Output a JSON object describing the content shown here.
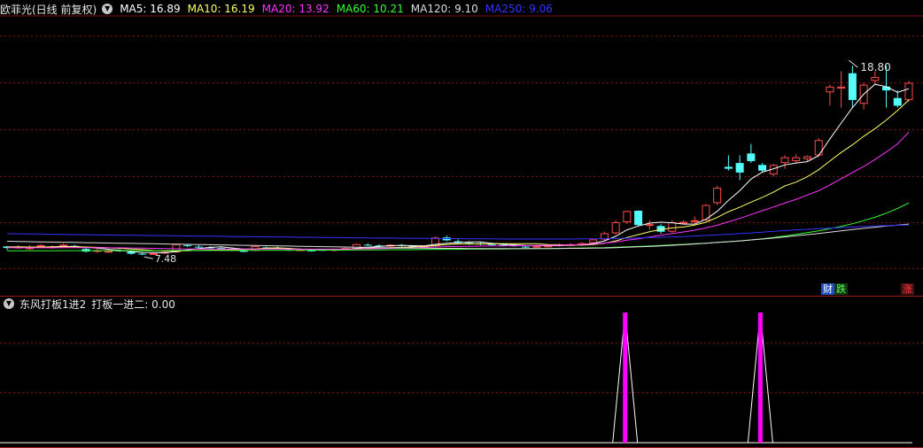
{
  "header": {
    "stock_name": "欧菲光(日线 前复权)",
    "ma": [
      {
        "label": "MA5: 16.89",
        "color": "#ffffff"
      },
      {
        "label": "MA10: 16.19",
        "color": "#ffff66"
      },
      {
        "label": "MA20: 13.92",
        "color": "#ff33ff"
      },
      {
        "label": "MA60: 10.21",
        "color": "#33ff33"
      },
      {
        "label": "MA120: 9.10",
        "color": "#dddddd"
      },
      {
        "label": "MA250: 9.06",
        "color": "#3333ff"
      }
    ]
  },
  "price_panel": {
    "high_label": "18.80",
    "low_label": "7.48",
    "tags": {
      "cai": "财",
      "die": "跌",
      "zhang": "涨"
    },
    "colors": {
      "up": "#ff4a4a",
      "down": "#54fcfc",
      "grid": "#7a1010"
    }
  },
  "indicator_panel": {
    "title": "东风打板1进2",
    "value_label": "打板一进二: 0.00",
    "signal_color": "#ff00ff"
  },
  "chart_data": {
    "type": "candlestick",
    "ylim": [
      6,
      20
    ],
    "candles": [
      [
        7.93,
        7.95,
        7.75,
        7.85
      ],
      [
        7.9,
        8.0,
        7.8,
        7.92
      ],
      [
        7.85,
        8.0,
        7.75,
        7.88
      ],
      [
        7.93,
        8.04,
        7.88,
        8.0
      ],
      [
        7.9,
        8.0,
        7.82,
        7.93
      ],
      [
        7.98,
        8.08,
        7.92,
        8.02
      ],
      [
        7.96,
        8.02,
        7.85,
        7.9
      ],
      [
        7.8,
        7.85,
        7.62,
        7.66
      ],
      [
        7.7,
        7.8,
        7.6,
        7.74
      ],
      [
        7.68,
        7.75,
        7.6,
        7.7
      ],
      [
        7.72,
        7.78,
        7.65,
        7.68
      ],
      [
        7.65,
        7.72,
        7.5,
        7.55
      ],
      [
        7.55,
        7.6,
        7.48,
        7.52
      ],
      [
        7.52,
        7.62,
        7.48,
        7.58
      ],
      [
        7.6,
        7.7,
        7.55,
        7.65
      ],
      [
        7.62,
        8.08,
        7.6,
        8.05
      ],
      [
        8.0,
        8.06,
        7.9,
        7.96
      ],
      [
        7.92,
        8.0,
        7.85,
        7.89
      ],
      [
        7.88,
        7.95,
        7.82,
        7.85
      ],
      [
        7.85,
        7.9,
        7.76,
        7.8
      ],
      [
        7.8,
        7.88,
        7.7,
        7.75
      ],
      [
        7.72,
        7.78,
        7.62,
        7.65
      ],
      [
        7.7,
        7.98,
        7.68,
        7.95
      ],
      [
        7.88,
        7.92,
        7.8,
        7.85
      ],
      [
        7.86,
        7.92,
        7.8,
        7.82
      ],
      [
        7.8,
        7.86,
        7.7,
        7.76
      ],
      [
        7.75,
        7.82,
        7.7,
        7.78
      ],
      [
        7.72,
        7.8,
        7.66,
        7.7
      ],
      [
        7.75,
        7.8,
        7.7,
        7.74
      ],
      [
        7.7,
        7.82,
        7.66,
        7.8
      ],
      [
        7.82,
        7.9,
        7.78,
        7.85
      ],
      [
        7.8,
        8.08,
        7.78,
        8.05
      ],
      [
        8.02,
        8.1,
        7.95,
        8.0
      ],
      [
        7.98,
        8.04,
        7.9,
        7.94
      ],
      [
        7.92,
        8.05,
        7.88,
        8.02
      ],
      [
        8.0,
        8.06,
        7.92,
        7.96
      ],
      [
        7.96,
        8.0,
        7.88,
        7.92
      ],
      [
        7.92,
        8.0,
        7.86,
        7.95
      ],
      [
        7.95,
        8.45,
        7.92,
        8.4
      ],
      [
        8.4,
        8.5,
        8.2,
        8.25
      ],
      [
        8.2,
        8.3,
        8.08,
        8.12
      ],
      [
        8.12,
        8.2,
        8.02,
        8.05
      ],
      [
        8.1,
        8.15,
        8.0,
        8.04
      ],
      [
        8.05,
        8.12,
        7.98,
        8.02
      ],
      [
        8.02,
        8.1,
        7.95,
        8.0
      ],
      [
        8.0,
        8.06,
        7.92,
        7.94
      ],
      [
        7.92,
        8.0,
        7.85,
        7.88
      ],
      [
        7.9,
        8.0,
        7.84,
        7.96
      ],
      [
        7.96,
        8.02,
        7.9,
        7.98
      ],
      [
        8.0,
        8.08,
        7.92,
        8.04
      ],
      [
        8.0,
        8.1,
        7.94,
        8.05
      ],
      [
        8.02,
        8.15,
        7.96,
        8.1
      ],
      [
        8.1,
        8.35,
        8.05,
        8.3
      ],
      [
        8.3,
        8.7,
        8.25,
        8.62
      ],
      [
        8.62,
        9.3,
        8.55,
        9.2
      ],
      [
        9.2,
        9.8,
        9.1,
        9.78
      ],
      [
        9.8,
        9.82,
        9.0,
        9.05
      ],
      [
        9.05,
        9.3,
        8.8,
        9.1
      ],
      [
        9.0,
        9.1,
        8.6,
        8.7
      ],
      [
        8.7,
        9.3,
        8.65,
        9.2
      ],
      [
        9.2,
        9.3,
        9.1,
        9.22
      ],
      [
        9.22,
        9.5,
        9.15,
        9.3
      ],
      [
        9.3,
        10.15,
        9.25,
        10.1
      ],
      [
        10.2,
        11.1,
        10.1,
        11.0
      ],
      [
        12.1,
        12.7,
        11.9,
        12.0
      ],
      [
        12.3,
        12.7,
        11.4,
        11.8
      ],
      [
        12.8,
        13.3,
        12.3,
        12.4
      ],
      [
        12.2,
        12.3,
        11.8,
        11.9
      ],
      [
        11.7,
        12.25,
        11.6,
        12.2
      ],
      [
        12.3,
        12.7,
        12.0,
        12.6
      ],
      [
        12.4,
        12.75,
        12.3,
        12.6
      ],
      [
        12.5,
        12.7,
        12.4,
        12.65
      ],
      [
        12.7,
        13.6,
        12.6,
        13.5
      ],
      [
        16.0,
        16.4,
        15.3,
        16.3
      ],
      [
        16.2,
        17.1,
        15.2,
        16.3
      ],
      [
        17.0,
        17.4,
        15.2,
        15.6
      ],
      [
        15.4,
        16.5,
        15.1,
        16.4
      ],
      [
        16.6,
        17.1,
        16.4,
        16.8
      ],
      [
        16.3,
        17.4,
        15.2,
        16.1
      ],
      [
        15.7,
        16.1,
        15.2,
        15.3
      ],
      [
        15.6,
        16.6,
        15.5,
        16.5
      ]
    ],
    "ma_series": [
      {
        "name": "MA5",
        "color": "#ffffff",
        "values": [
          7.9,
          7.91,
          7.9,
          7.9,
          7.91,
          7.93,
          7.93,
          7.89,
          7.84,
          7.78,
          7.73,
          7.67,
          7.62,
          7.61,
          7.6,
          7.66,
          7.75,
          7.82,
          7.88,
          7.91,
          7.85,
          7.79,
          7.8,
          7.81,
          7.81,
          7.8,
          7.79,
          7.77,
          7.76,
          7.76,
          7.77,
          7.83,
          7.89,
          7.93,
          7.97,
          7.99,
          7.97,
          7.96,
          8.04,
          8.1,
          8.13,
          8.17,
          8.17,
          8.1,
          8.05,
          8.01,
          7.98,
          7.97,
          7.97,
          7.98,
          8.0,
          8.02,
          8.09,
          8.22,
          8.46,
          8.8,
          9.0,
          9.15,
          9.2,
          9.17,
          9.1,
          9.1,
          9.35,
          9.77,
          10.35,
          10.85,
          11.46,
          11.82,
          12.0,
          12.2,
          12.3,
          12.37,
          12.69,
          13.56,
          14.39,
          15.2,
          15.9,
          16.42,
          16.3,
          16.0,
          16.19
        ]
      },
      {
        "name": "MA10",
        "color": "#ffff66",
        "values": [
          7.9,
          7.9,
          7.9,
          7.9,
          7.9,
          7.91,
          7.91,
          7.9,
          7.88,
          7.86,
          7.83,
          7.8,
          7.76,
          7.72,
          7.69,
          7.69,
          7.71,
          7.72,
          7.74,
          7.75,
          7.75,
          7.77,
          7.8,
          7.84,
          7.86,
          7.83,
          7.79,
          7.78,
          7.78,
          7.78,
          7.78,
          7.81,
          7.83,
          7.85,
          7.86,
          7.88,
          7.9,
          7.93,
          7.98,
          8.03,
          8.06,
          8.07,
          8.06,
          8.07,
          8.07,
          8.07,
          8.07,
          8.07,
          8.03,
          8.02,
          8.01,
          8.0,
          8.03,
          8.1,
          8.22,
          8.4,
          8.55,
          8.7,
          8.82,
          8.9,
          8.95,
          9.05,
          9.2,
          9.45,
          9.75,
          9.98,
          10.25,
          10.5,
          10.78,
          11.1,
          11.3,
          11.58,
          11.95,
          12.4,
          12.85,
          13.25,
          13.7,
          14.1,
          14.55,
          15.05,
          15.6
        ]
      },
      {
        "name": "MA20",
        "color": "#ff33ff",
        "values": [
          7.86,
          7.86,
          7.86,
          7.86,
          7.86,
          7.87,
          7.87,
          7.87,
          7.87,
          7.86,
          7.86,
          7.85,
          7.84,
          7.83,
          7.82,
          7.81,
          7.8,
          7.8,
          7.8,
          7.8,
          7.8,
          7.8,
          7.8,
          7.8,
          7.8,
          7.79,
          7.79,
          7.79,
          7.79,
          7.79,
          7.79,
          7.8,
          7.81,
          7.82,
          7.83,
          7.85,
          7.86,
          7.88,
          7.9,
          7.92,
          7.93,
          7.94,
          7.95,
          7.96,
          7.96,
          7.97,
          7.97,
          7.98,
          7.99,
          8.0,
          8.01,
          8.03,
          8.06,
          8.11,
          8.17,
          8.26,
          8.33,
          8.42,
          8.52,
          8.6,
          8.69,
          8.78,
          8.9,
          9.04,
          9.22,
          9.4,
          9.6,
          9.8,
          10.0,
          10.2,
          10.4,
          10.62,
          10.85,
          11.15,
          11.48,
          11.8,
          12.12,
          12.48,
          12.88,
          13.3,
          13.92
        ]
      },
      {
        "name": "MA60",
        "color": "#33ff33",
        "values": [
          7.7,
          7.7,
          7.7,
          7.7,
          7.7,
          7.71,
          7.71,
          7.71,
          7.71,
          7.71,
          7.71,
          7.71,
          7.71,
          7.71,
          7.71,
          7.72,
          7.72,
          7.72,
          7.72,
          7.72,
          7.72,
          7.72,
          7.73,
          7.73,
          7.73,
          7.73,
          7.73,
          7.73,
          7.74,
          7.74,
          7.74,
          7.75,
          7.75,
          7.75,
          7.76,
          7.76,
          7.76,
          7.77,
          7.77,
          7.78,
          7.78,
          7.79,
          7.79,
          7.8,
          7.8,
          7.81,
          7.81,
          7.82,
          7.82,
          7.83,
          7.84,
          7.85,
          7.86,
          7.87,
          7.89,
          7.91,
          7.93,
          7.95,
          7.98,
          8.01,
          8.04,
          8.07,
          8.1,
          8.14,
          8.18,
          8.22,
          8.27,
          8.33,
          8.4,
          8.48,
          8.56,
          8.65,
          8.75,
          8.86,
          8.98,
          9.12,
          9.28,
          9.46,
          9.67,
          9.92,
          10.21
        ]
      },
      {
        "name": "MA120",
        "color": "#dddddd",
        "values": [
          8.2,
          8.19,
          8.18,
          8.17,
          8.16,
          8.15,
          8.14,
          8.13,
          8.12,
          8.11,
          8.1,
          8.09,
          8.08,
          8.07,
          8.06,
          8.05,
          8.04,
          8.03,
          8.02,
          8.01,
          8.0,
          7.99,
          7.98,
          7.97,
          7.96,
          7.95,
          7.94,
          7.93,
          7.92,
          7.91,
          7.9,
          7.89,
          7.88,
          7.87,
          7.86,
          7.85,
          7.84,
          7.84,
          7.83,
          7.83,
          7.83,
          7.82,
          7.82,
          7.82,
          7.82,
          7.82,
          7.82,
          7.82,
          7.82,
          7.82,
          7.83,
          7.83,
          7.84,
          7.85,
          7.87,
          7.89,
          7.91,
          7.93,
          7.96,
          7.99,
          8.02,
          8.06,
          8.1,
          8.14,
          8.18,
          8.22,
          8.27,
          8.32,
          8.37,
          8.43,
          8.49,
          8.55,
          8.61,
          8.68,
          8.75,
          8.82,
          8.88,
          8.94,
          9.0,
          9.05,
          9.1
        ]
      },
      {
        "name": "MA250",
        "color": "#3333ff",
        "values": [
          8.6,
          8.59,
          8.58,
          8.58,
          8.57,
          8.56,
          8.55,
          8.55,
          8.54,
          8.53,
          8.52,
          8.52,
          8.51,
          8.5,
          8.5,
          8.49,
          8.48,
          8.47,
          8.47,
          8.46,
          8.45,
          8.45,
          8.44,
          8.43,
          8.43,
          8.42,
          8.41,
          8.41,
          8.4,
          8.4,
          8.39,
          8.38,
          8.38,
          8.37,
          8.37,
          8.36,
          8.36,
          8.35,
          8.35,
          8.34,
          8.34,
          8.33,
          8.33,
          8.33,
          8.32,
          8.32,
          8.32,
          8.32,
          8.32,
          8.32,
          8.32,
          8.33,
          8.33,
          8.34,
          8.35,
          8.36,
          8.37,
          8.39,
          8.41,
          8.43,
          8.45,
          8.48,
          8.51,
          8.54,
          8.57,
          8.61,
          8.64,
          8.68,
          8.72,
          8.76,
          8.8,
          8.83,
          8.86,
          8.89,
          8.92,
          8.95,
          8.98,
          9.0,
          9.02,
          9.04,
          9.06
        ]
      }
    ],
    "signal_values_ylim": [
      0,
      1
    ],
    "signal_indices": [
      52,
      64
    ]
  }
}
